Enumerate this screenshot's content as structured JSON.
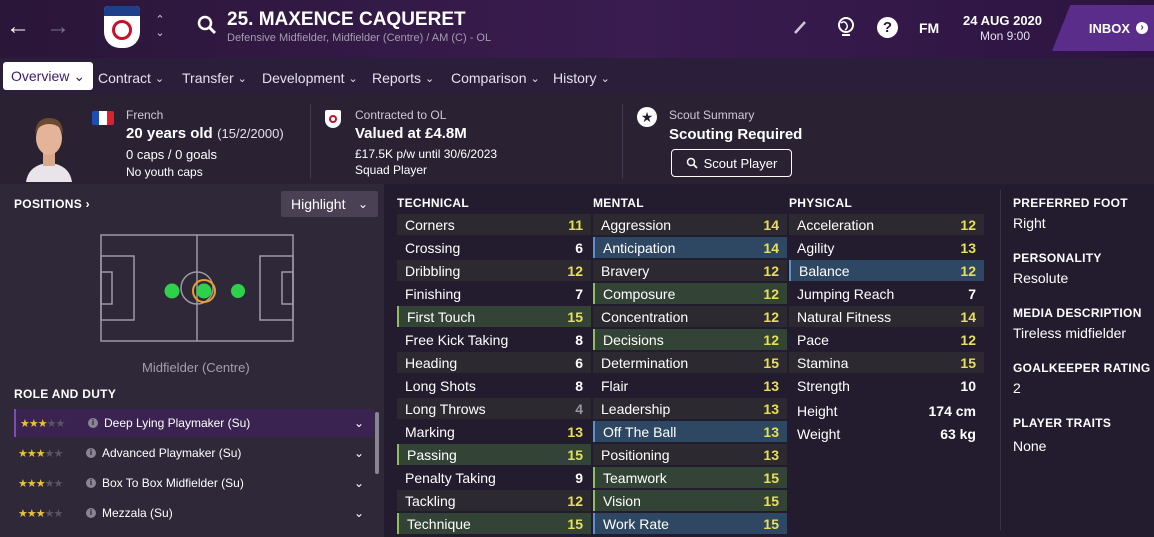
{
  "header": {
    "player_name": "25. MAXENCE CAQUERET",
    "subtitle": "Defensive Midfielder, Midfielder (Centre) / AM (C) - OL",
    "fm_label": "FM",
    "date": "24 AUG 2020",
    "time": "Mon 9:00",
    "inbox_label": "INBOX",
    "club_badge_text": "OLYMPIQUE LYONNAIS"
  },
  "tabs": [
    {
      "label": "Overview"
    },
    {
      "label": "Contract"
    },
    {
      "label": "Transfer"
    },
    {
      "label": "Development"
    },
    {
      "label": "Reports"
    },
    {
      "label": "Comparison"
    },
    {
      "label": "History"
    }
  ],
  "info": {
    "nationality": "French",
    "age": "20 years old",
    "dob": "(15/2/2000)",
    "caps": "0 caps / 0 goals",
    "youth_caps": "No youth caps",
    "contract_label": "Contracted to OL",
    "value": "Valued at £4.8M",
    "wage": "£17.5K p/w until 30/6/2023",
    "squad_status": "Squad Player",
    "scout_label": "Scout Summary",
    "scouting": "Scouting Required",
    "scout_button": "Scout Player"
  },
  "positions": {
    "title": "POSITIONS",
    "highlight_label": "Highlight",
    "position_label": "Midfielder (Centre)",
    "role_title": "ROLE AND DUTY",
    "roles": [
      {
        "name": "Deep Lying Playmaker (Su)",
        "stars": 2.5
      },
      {
        "name": "Advanced Playmaker (Su)",
        "stars": 2.5
      },
      {
        "name": "Box To Box Midfielder (Su)",
        "stars": 2.5
      },
      {
        "name": "Mezzala (Su)",
        "stars": 2.5
      }
    ]
  },
  "attributes": {
    "technical_title": "TECHNICAL",
    "mental_title": "MENTAL",
    "physical_title": "PHYSICAL",
    "technical": [
      {
        "name": "Corners",
        "value": "11",
        "style": "alt"
      },
      {
        "name": "Crossing",
        "value": "6",
        "style": ""
      },
      {
        "name": "Dribbling",
        "value": "12",
        "style": "alt"
      },
      {
        "name": "Finishing",
        "value": "7",
        "style": ""
      },
      {
        "name": "First Touch",
        "value": "15",
        "style": "key"
      },
      {
        "name": "Free Kick Taking",
        "value": "8",
        "style": ""
      },
      {
        "name": "Heading",
        "value": "6",
        "style": "alt"
      },
      {
        "name": "Long Shots",
        "value": "8",
        "style": ""
      },
      {
        "name": "Long Throws",
        "value": "4",
        "style": "alt"
      },
      {
        "name": "Marking",
        "value": "13",
        "style": ""
      },
      {
        "name": "Passing",
        "value": "15",
        "style": "key"
      },
      {
        "name": "Penalty Taking",
        "value": "9",
        "style": ""
      },
      {
        "name": "Tackling",
        "value": "12",
        "style": "alt"
      },
      {
        "name": "Technique",
        "value": "15",
        "style": "key"
      }
    ],
    "mental": [
      {
        "name": "Aggression",
        "value": "14",
        "style": "alt"
      },
      {
        "name": "Anticipation",
        "value": "14",
        "style": "hi"
      },
      {
        "name": "Bravery",
        "value": "12",
        "style": "alt"
      },
      {
        "name": "Composure",
        "value": "12",
        "style": "key"
      },
      {
        "name": "Concentration",
        "value": "12",
        "style": "alt"
      },
      {
        "name": "Decisions",
        "value": "12",
        "style": "key"
      },
      {
        "name": "Determination",
        "value": "15",
        "style": "alt"
      },
      {
        "name": "Flair",
        "value": "13",
        "style": ""
      },
      {
        "name": "Leadership",
        "value": "13",
        "style": "alt"
      },
      {
        "name": "Off The Ball",
        "value": "13",
        "style": "hi"
      },
      {
        "name": "Positioning",
        "value": "13",
        "style": "alt"
      },
      {
        "name": "Teamwork",
        "value": "15",
        "style": "key"
      },
      {
        "name": "Vision",
        "value": "15",
        "style": "key"
      },
      {
        "name": "Work Rate",
        "value": "15",
        "style": "hi"
      }
    ],
    "physical": [
      {
        "name": "Acceleration",
        "value": "12",
        "style": "alt"
      },
      {
        "name": "Agility",
        "value": "13",
        "style": ""
      },
      {
        "name": "Balance",
        "value": "12",
        "style": "hi"
      },
      {
        "name": "Jumping Reach",
        "value": "7",
        "style": ""
      },
      {
        "name": "Natural Fitness",
        "value": "14",
        "style": "alt"
      },
      {
        "name": "Pace",
        "value": "12",
        "style": ""
      },
      {
        "name": "Stamina",
        "value": "15",
        "style": "alt"
      },
      {
        "name": "Strength",
        "value": "10",
        "style": ""
      }
    ],
    "height_label": "Height",
    "height_value": "174 cm",
    "weight_label": "Weight",
    "weight_value": "63 kg"
  },
  "side": {
    "foot_title": "PREFERRED FOOT",
    "foot": "Right",
    "personality_title": "PERSONALITY",
    "personality": "Resolute",
    "media_title": "MEDIA DESCRIPTION",
    "media": "Tireless midfielder",
    "gk_title": "GOALKEEPER RATING",
    "gk": "2",
    "traits_title": "PLAYER TRAITS",
    "traits": "None"
  }
}
